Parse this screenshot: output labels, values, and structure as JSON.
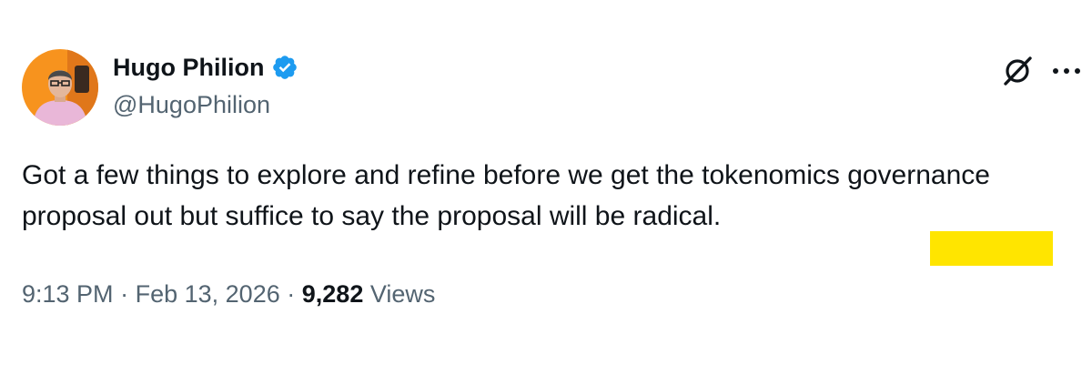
{
  "author": {
    "display_name": "Hugo Philion",
    "handle": "@HugoPhilion",
    "verified": true,
    "verified_color": "#1d9bf0",
    "avatar_icon": "profile-photo"
  },
  "tweet": {
    "text": "Got a few things to explore and refine before we get the tokenomics governance proposal out but suffice to say the proposal will be radical.",
    "time": "9:13 PM",
    "date": "Feb 13, 2026",
    "separator": "·",
    "views_count": "9,282",
    "views_label": "Views"
  },
  "actions": {
    "grok_icon": "grok-icon",
    "more_icon": "more-icon"
  },
  "colors": {
    "text_primary": "#0f1419",
    "text_secondary": "#536471",
    "highlight": "#ffe500",
    "avatar_bg": "#f7931e"
  }
}
